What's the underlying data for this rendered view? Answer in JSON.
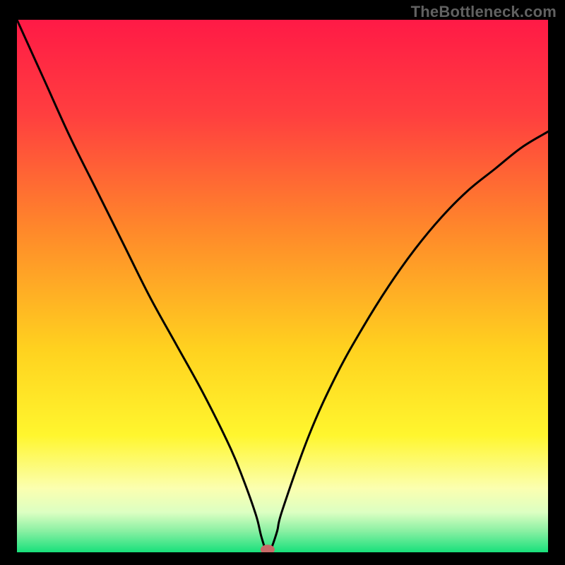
{
  "watermark": "TheBottleneck.com",
  "chart_data": {
    "type": "line",
    "title": "",
    "xlabel": "",
    "ylabel": "",
    "xlim": [
      0,
      100
    ],
    "ylim": [
      0,
      100
    ],
    "series": [
      {
        "name": "bottleneck-curve",
        "x": [
          0,
          5,
          10,
          15,
          20,
          25,
          30,
          35,
          40,
          42.5,
          45,
          46,
          47,
          47.5,
          48,
          49,
          50,
          55,
          60,
          65,
          70,
          75,
          80,
          85,
          90,
          95,
          100
        ],
        "y": [
          100,
          89,
          78,
          68,
          58,
          48,
          39,
          30,
          20,
          14,
          7,
          3,
          0,
          0,
          1,
          4,
          8,
          22,
          33,
          42,
          50,
          57,
          63,
          68,
          72,
          76,
          79
        ]
      }
    ],
    "marker": {
      "x": 47.2,
      "y": 0.5
    },
    "gradient_stops": [
      {
        "offset": 0,
        "color": "#ff1a46"
      },
      {
        "offset": 18,
        "color": "#ff3f3f"
      },
      {
        "offset": 40,
        "color": "#ff8a2a"
      },
      {
        "offset": 62,
        "color": "#ffd21f"
      },
      {
        "offset": 78,
        "color": "#fff62e"
      },
      {
        "offset": 88,
        "color": "#fbffb0"
      },
      {
        "offset": 92.5,
        "color": "#dcffc2"
      },
      {
        "offset": 96,
        "color": "#8af0a3"
      },
      {
        "offset": 100,
        "color": "#18e07b"
      }
    ],
    "marker_color": "#c86b68",
    "curve_color": "#000000",
    "curve_width": 3
  }
}
